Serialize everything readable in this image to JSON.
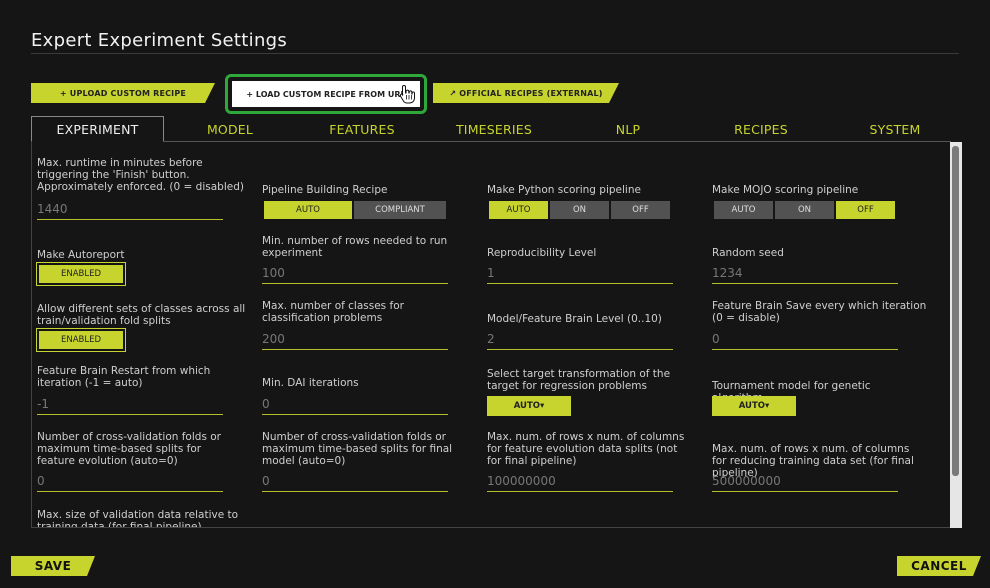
{
  "dialog": {
    "title": "Expert Experiment Settings"
  },
  "recipe_buttons": {
    "upload": "+ UPLOAD CUSTOM RECIPE",
    "load_url": "+ LOAD CUSTOM RECIPE FROM URL",
    "official": "↗ OFFICIAL RECIPES (EXTERNAL)"
  },
  "tabs": [
    "EXPERIMENT",
    "MODEL",
    "FEATURES",
    "TIMESERIES",
    "NLP",
    "RECIPES",
    "SYSTEM"
  ],
  "settings": {
    "max_runtime": {
      "label": "Max. runtime in minutes before triggering the 'Finish' button. Approximately enforced. (0 = disabled)",
      "placeholder": "1440"
    },
    "pipeline_recipe": {
      "label": "Pipeline Building Recipe",
      "options": [
        "AUTO",
        "COMPLIANT"
      ],
      "selected": "AUTO"
    },
    "python_scoring": {
      "label": "Make Python scoring pipeline",
      "options": [
        "AUTO",
        "ON",
        "OFF"
      ],
      "selected": "AUTO"
    },
    "mojo_scoring": {
      "label": "Make MOJO scoring pipeline",
      "options": [
        "AUTO",
        "ON",
        "OFF"
      ],
      "selected": "OFF"
    },
    "autoreport": {
      "label": "Make Autoreport",
      "value": "ENABLED"
    },
    "min_rows": {
      "label": "Min. number of rows needed to run experiment",
      "placeholder": "100"
    },
    "reproducibility": {
      "label": "Reproducibility Level",
      "placeholder": "1"
    },
    "random_seed": {
      "label": "Random seed",
      "placeholder": "1234"
    },
    "diff_classes": {
      "label": "Allow different sets of classes across all train/validation fold splits",
      "value": "ENABLED"
    },
    "max_classes": {
      "label": "Max. number of classes for classification problems",
      "placeholder": "200"
    },
    "brain_level": {
      "label": "Model/Feature Brain Level (0..10)",
      "placeholder": "2"
    },
    "brain_save": {
      "label": "Feature Brain Save every which iteration (0 = disable)",
      "placeholder": "0"
    },
    "brain_restart": {
      "label": "Feature Brain Restart from which iteration (-1 = auto)",
      "placeholder": "-1"
    },
    "min_dai_iter": {
      "label": "Min. DAI iterations",
      "placeholder": "0"
    },
    "target_transform": {
      "label": "Select target transformation of the target for regression problems",
      "value": "AUTO▾"
    },
    "tournament_model": {
      "label": "Tournament model for genetic algorithm",
      "value": "AUTO▾"
    },
    "cv_folds_feat": {
      "label": "Number of cross-validation folds or maximum time-based splits for feature evolution (auto=0)",
      "placeholder": "0"
    },
    "cv_folds_final": {
      "label": "Number of cross-validation folds or maximum time-based splits for final model (auto=0)",
      "placeholder": "0"
    },
    "max_rows_feat": {
      "label": "Max. num. of rows x num. of columns for feature evolution data splits (not for final pipeline)",
      "placeholder": "100000000"
    },
    "max_rows_final": {
      "label": "Max. num. of rows x num. of columns for reducing training data set (for final pipeline)",
      "placeholder": "500000000"
    },
    "max_val_size": {
      "label": "Max. size of validation data relative to training data (for final pipeline), otherwise"
    }
  },
  "footer": {
    "save": "SAVE",
    "cancel": "CANCEL"
  },
  "colors": {
    "accent": "#c8d42e",
    "focus": "#2fa83a",
    "background": "#151515"
  }
}
